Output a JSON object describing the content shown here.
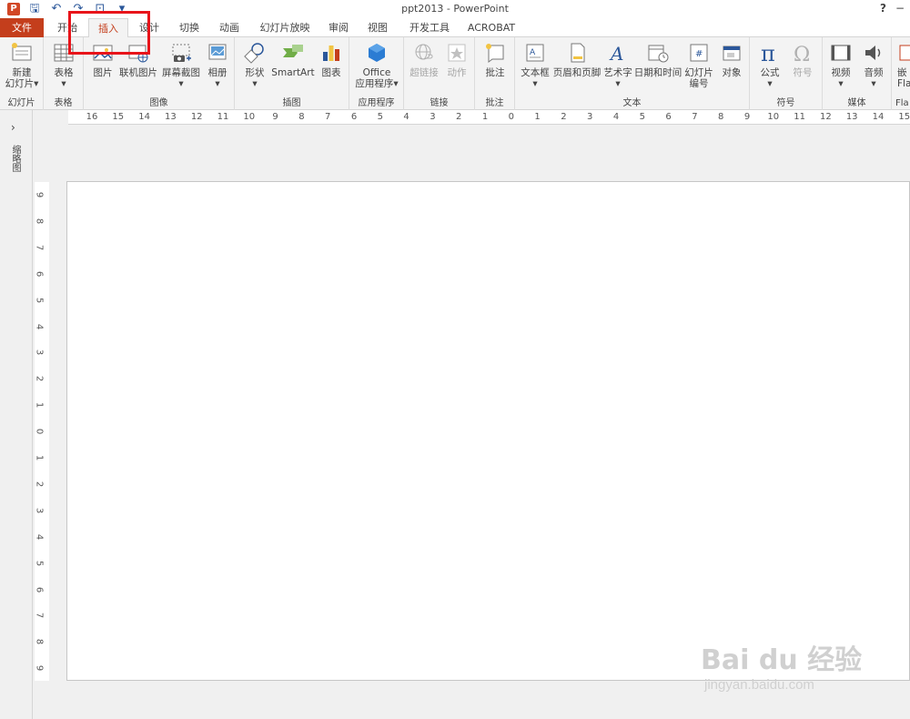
{
  "window": {
    "title": "ppt2013 - PowerPoint",
    "app_logo": "P",
    "help": "?",
    "control": "−"
  },
  "tabs": [
    "文件",
    "开始",
    "插入",
    "设计",
    "切换",
    "动画",
    "幻灯片放映",
    "审阅",
    "视图",
    "开发工具",
    "ACROBAT"
  ],
  "active_tab": "插入",
  "ribbon": {
    "groups": {
      "slides": "幻灯片",
      "tables": "表格",
      "images": "图像",
      "illustrations": "插图",
      "apps": "应用程序",
      "links": "链接",
      "comments": "批注",
      "text": "文本",
      "symbols": "符号",
      "media": "媒体",
      "flash": "Fla"
    },
    "buttons": {
      "new_slide_1": "新建",
      "new_slide_2": "幻灯片",
      "table": "表格",
      "picture": "图片",
      "online_picture": "联机图片",
      "screenshot": "屏幕截图",
      "album": "相册",
      "shapes": "形状",
      "smartart": "SmartArt",
      "chart": "图表",
      "office_apps_1": "Office",
      "office_apps_2": "应用程序",
      "hyperlink": "超链接",
      "action": "动作",
      "comment": "批注",
      "textbox": "文本框",
      "header_footer": "页眉和页脚",
      "wordart": "艺术字",
      "datetime": "日期和时间",
      "slide_number_1": "幻灯片",
      "slide_number_2": "编号",
      "object": "对象",
      "equation": "公式",
      "symbol": "符号",
      "video": "视频",
      "audio": "音频",
      "flash_1": "嵌",
      "flash_2": "Fla"
    }
  },
  "ruler": {
    "h_labels": [
      "16",
      "15",
      "14",
      "13",
      "12",
      "11",
      "10",
      "9",
      "8",
      "7",
      "6",
      "5",
      "4",
      "3",
      "2",
      "1",
      "0",
      "1",
      "2",
      "3",
      "4",
      "5",
      "6",
      "7",
      "8",
      "9",
      "10",
      "11",
      "12",
      "13",
      "14",
      "15"
    ],
    "v_labels": [
      "9",
      "8",
      "7",
      "6",
      "5",
      "4",
      "3",
      "2",
      "1",
      "0",
      "1",
      "2",
      "3",
      "4",
      "5",
      "6",
      "7",
      "8",
      "9"
    ]
  },
  "thumbnail_pane": {
    "label": "缩略图",
    "arrow": "›"
  },
  "watermark": {
    "logo": "Bai du 经验",
    "url": "jingyan.baidu.com"
  },
  "colors": {
    "accent": "#c43e1c",
    "highlight": "#e8141a",
    "icon_blue": "#2b579a"
  }
}
